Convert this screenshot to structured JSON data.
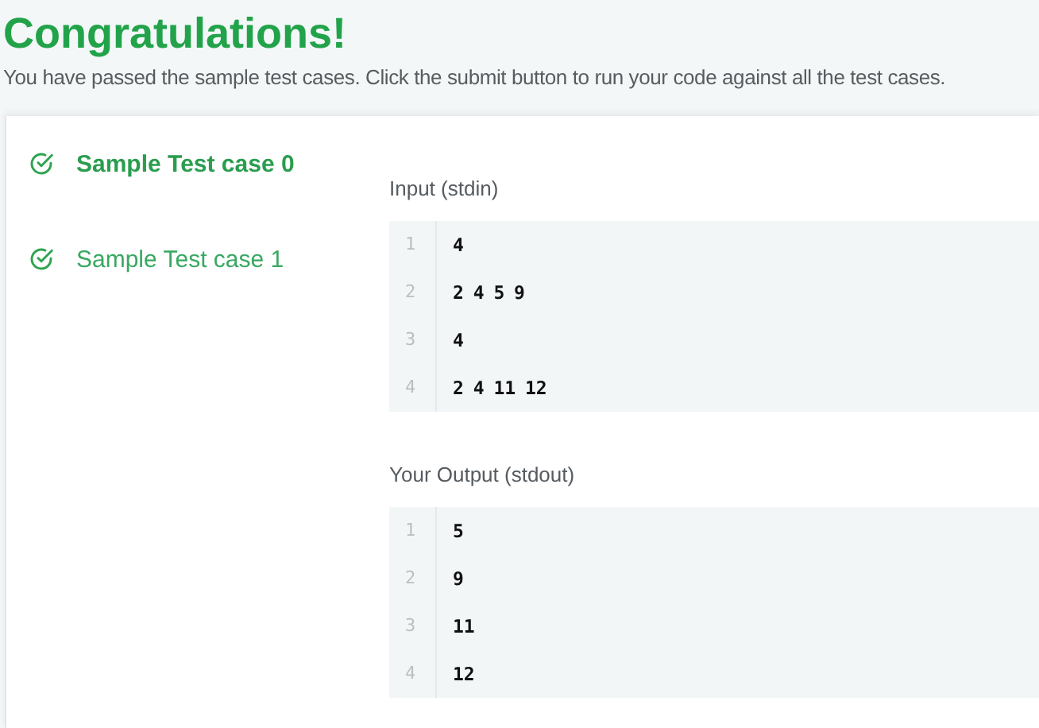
{
  "header": {
    "title": "Congratulations!",
    "message": "You have passed the sample test cases. Click the submit button to run your code against all the test cases."
  },
  "test_cases": [
    {
      "label": "Sample Test case 0",
      "selected": true
    },
    {
      "label": "Sample Test case 1",
      "selected": false
    }
  ],
  "sections": [
    {
      "label": "Input (stdin)",
      "lines": [
        {
          "number": "1",
          "text": "4"
        },
        {
          "number": "2",
          "text": "2 4 5 9"
        },
        {
          "number": "3",
          "text": "4"
        },
        {
          "number": "4",
          "text": "2 4 11 12"
        }
      ]
    },
    {
      "label": "Your Output (stdout)",
      "lines": [
        {
          "number": "1",
          "text": "5"
        },
        {
          "number": "2",
          "text": "9"
        },
        {
          "number": "3",
          "text": "11"
        },
        {
          "number": "4",
          "text": "12"
        }
      ]
    }
  ]
}
